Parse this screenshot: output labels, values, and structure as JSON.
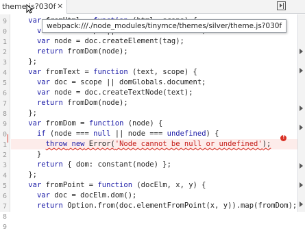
{
  "tab": {
    "label": "theme.js?030f",
    "close": "×"
  },
  "tooltip": {
    "text": "webpack:///./node_modules/tinymce/themes/silver/theme.js?030f"
  },
  "gutter": {
    "numbers": [
      "9",
      "0",
      "1",
      "2",
      "3",
      "4",
      "5",
      "6",
      "7",
      "8",
      "9",
      "0",
      "1",
      "2",
      "3",
      "4",
      "5",
      "6",
      "7",
      "8",
      "9"
    ]
  },
  "code": {
    "lines": [
      "    var fromHtml = function (html, scope) {",
      "      var doc = scope || domGlobals.document;",
      "      var node = doc.createElement(tag);",
      "      return fromDom(node);",
      "    };",
      "    var fromText = function (text, scope) {",
      "      var doc = scope || domGlobals.document;",
      "      var node = doc.createTextNode(text);",
      "      return fromDom(node);",
      "    };",
      "    var fromDom = function (node) {",
      "      if (node === null || node === undefined) {",
      "        throw new Error('Node cannot be null or undefined');",
      "      }",
      "      return { dom: constant(node) };",
      "    };",
      "    var fromPoint = function (docElm, x, y) {",
      "      var doc = docElm.dom();",
      "      return Option.from(doc.elementFromPoint(x, y)).map(fromDom);",
      "    };",
      ""
    ],
    "error_line_index": 12
  },
  "icons": {
    "close": "close-icon",
    "panel": "toggle-panel-icon",
    "error": "error-icon",
    "cursor": "mouse-cursor-icon"
  },
  "colors": {
    "keyword": "#1a1aa6",
    "string": "#c41a16",
    "error": "#d93025",
    "error_bg": "#fdecea"
  }
}
